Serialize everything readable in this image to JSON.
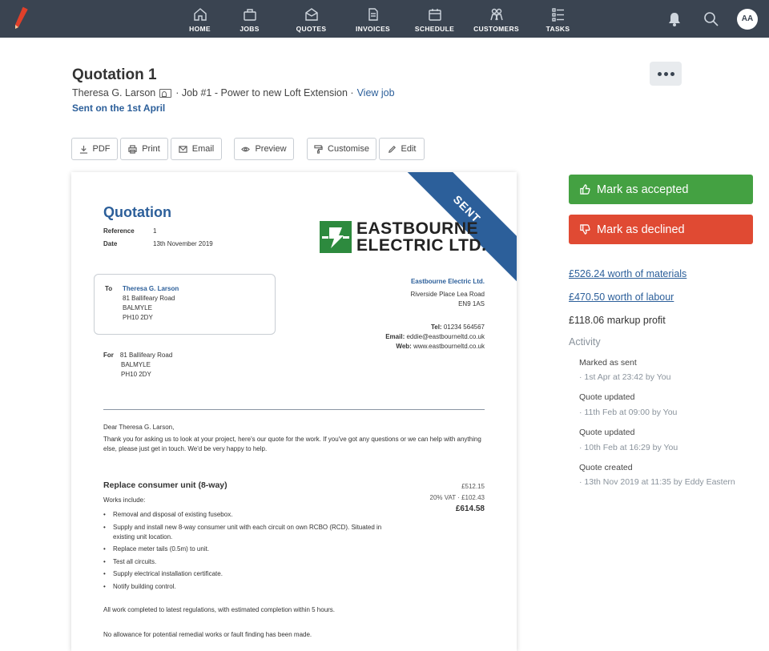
{
  "nav": {
    "items": [
      {
        "label": "HOME",
        "icon": "home-icon"
      },
      {
        "label": "JOBS",
        "icon": "jobs-icon"
      },
      {
        "label": "QUOTES",
        "icon": "quotes-icon"
      },
      {
        "label": "INVOICES",
        "icon": "invoices-icon"
      },
      {
        "label": "SCHEDULE",
        "icon": "calendar-icon"
      },
      {
        "label": "CUSTOMERS",
        "icon": "customers-icon"
      },
      {
        "label": "TASKS",
        "icon": "tasks-icon"
      }
    ],
    "avatar_initials": "AA"
  },
  "header": {
    "title": "Quotation 1",
    "customer": "Theresa G. Larson",
    "job_text": "· Job #1 - Power to new Loft Extension ·",
    "view_job": "View job",
    "sent_on": "Sent on the 1st April"
  },
  "toolbar": {
    "pdf": "PDF",
    "print": "Print",
    "email": "Email",
    "preview": "Preview",
    "customise": "Customise",
    "edit": "Edit"
  },
  "document": {
    "ribbon": "SENT",
    "title": "Quotation",
    "reference_label": "Reference",
    "reference_value": "1",
    "date_label": "Date",
    "date_value": "13th November 2019",
    "logo_line1": "EASTBOURNE",
    "logo_line2": "ELECTRIC LTD.",
    "to_label": "To",
    "to_name": "Theresa G. Larson",
    "to_address": [
      "81 Ballifeary Road",
      "BALMYLE",
      "PH10 2DY"
    ],
    "company_name": "Eastbourne Electric Ltd.",
    "company_address": [
      "Riverside Place Lea Road",
      "EN9 1AS"
    ],
    "tel_label": "Tel:",
    "tel": "01234 564567",
    "email_label": "Email:",
    "email": "eddie@eastbourneltd.co.uk",
    "web_label": "Web:",
    "web": "www.eastbourneltd.co.uk",
    "for_label": "For",
    "for_address": [
      "81 Ballifeary Road",
      "BALMYLE",
      "PH10 2DY"
    ],
    "greeting": "Dear Theresa G. Larson,",
    "intro": "Thank you for asking us to look at your project, here's our quote for the work. If you've got any questions or we can help with anything else, please just get in touch. We'd be very happy to help.",
    "item_title": "Replace consumer unit (8-way)",
    "works_include": "Works include:",
    "bullets": [
      "Removal and disposal of existing fusebox.",
      "Supply and install new 8-way consumer unit with each circuit on own RCBO (RCD). Situated in existing unit location.",
      "Replace meter tails (0.5m) to unit.",
      "Test all circuits.",
      "Supply electrical installation certificate.",
      "Notify building control."
    ],
    "subtotal": "£512.15",
    "vat": "20% VAT · £102.43",
    "total": "£614.58",
    "completion_note": "All work completed to latest regulations, with estimated completion within 5 hours.",
    "allowance_note": "No allowance for potential remedial works or fault finding has been made."
  },
  "side": {
    "accept": "Mark as accepted",
    "decline": "Mark as declined",
    "materials": "£526.24 worth of materials",
    "labour": "£470.50 worth of labour",
    "markup": "£118.06 markup profit",
    "activity_heading": "Activity",
    "activity": [
      {
        "title": "Marked as sent",
        "meta": "· 1st Apr at 23:42 by You"
      },
      {
        "title": "Quote updated",
        "meta": "· 11th Feb at 09:00 by You"
      },
      {
        "title": "Quote updated",
        "meta": "· 10th Feb at 16:29 by You"
      },
      {
        "title": "Quote created",
        "meta": "· 13th Nov 2019 at 11:35 by Eddy Eastern"
      }
    ]
  }
}
